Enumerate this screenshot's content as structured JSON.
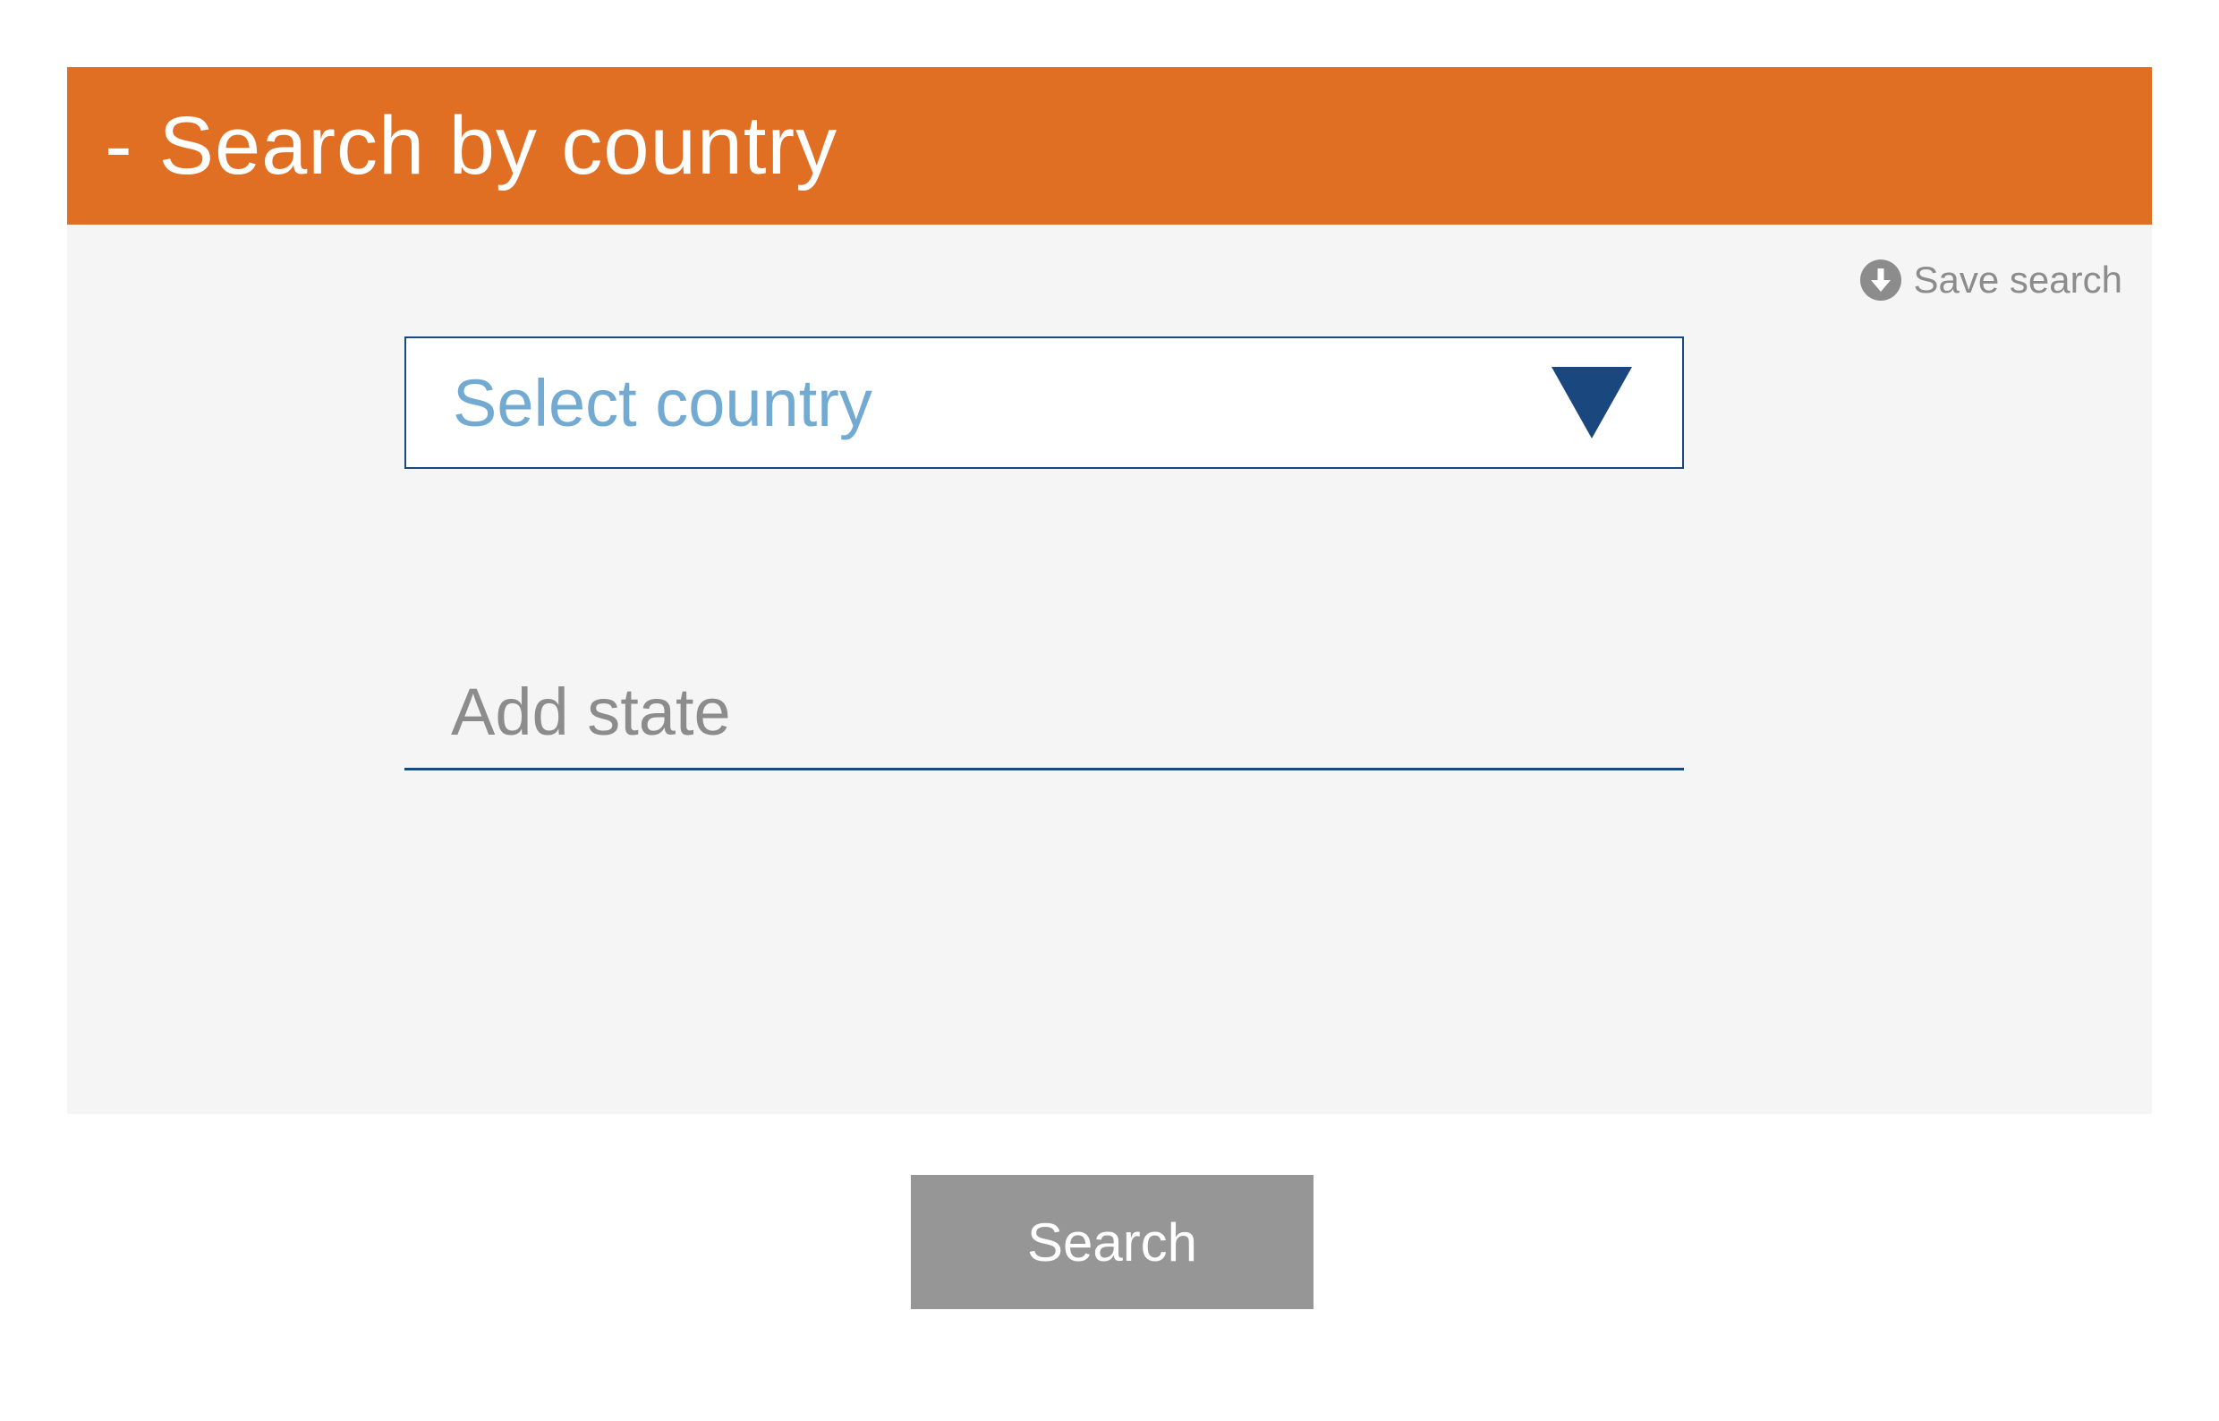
{
  "panel": {
    "collapse_sign": "-",
    "title": "Search by country",
    "save_search_label": "Save search",
    "save_search_icon": "download-circle-icon"
  },
  "country_select": {
    "selected_value": "Select country",
    "dropdown_icon": "triangle-down-icon"
  },
  "state_field": {
    "value": "",
    "placeholder": "Add state"
  },
  "search_button": {
    "label": "Search"
  },
  "colors": {
    "header_bg": "#e06e23",
    "panel_bg": "#f5f5f5",
    "accent": "#1a477d",
    "select_text": "#72aad2",
    "muted_text": "#8c8c8c",
    "button_bg": "#969696"
  }
}
